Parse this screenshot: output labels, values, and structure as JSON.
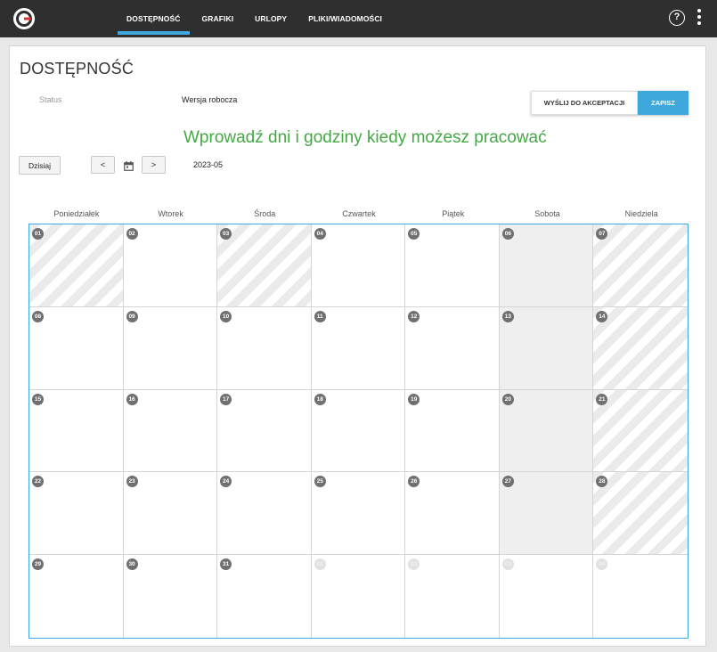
{
  "nav": {
    "items": [
      {
        "label": "DOSTĘPNOŚĆ",
        "active": true
      },
      {
        "label": "GRAFIKI",
        "active": false
      },
      {
        "label": "URLOPY",
        "active": false
      },
      {
        "label": "PLIKI/WIADOMOŚCI",
        "active": false
      }
    ],
    "help_glyph": "?"
  },
  "page": {
    "title": "DOSTĘPNOŚĆ",
    "status_label": "Status",
    "status_value": "Wersja robocza",
    "send_button": "WYŚLIJ DO AKCEPTACJI",
    "save_button": "ZAPISZ",
    "headline": "Wprowadź dni i godziny kiedy możesz pracować"
  },
  "toolbar": {
    "today_label": "Dzisiaj",
    "prev_label": "<",
    "next_label": ">",
    "month": "2023-05"
  },
  "calendar": {
    "weekdays": [
      "Poniedziałek",
      "Wtorek",
      "Środa",
      "Czwartek",
      "Piątek",
      "Sobota",
      "Niedziela"
    ],
    "days": [
      {
        "n": "01",
        "style": "striped"
      },
      {
        "n": "02",
        "style": "plain"
      },
      {
        "n": "03",
        "style": "striped"
      },
      {
        "n": "04",
        "style": "plain"
      },
      {
        "n": "05",
        "style": "plain"
      },
      {
        "n": "06",
        "style": "gray"
      },
      {
        "n": "07",
        "style": "striped"
      },
      {
        "n": "08",
        "style": "plain"
      },
      {
        "n": "09",
        "style": "plain"
      },
      {
        "n": "10",
        "style": "plain"
      },
      {
        "n": "11",
        "style": "plain"
      },
      {
        "n": "12",
        "style": "plain"
      },
      {
        "n": "13",
        "style": "gray"
      },
      {
        "n": "14",
        "style": "striped"
      },
      {
        "n": "15",
        "style": "plain"
      },
      {
        "n": "16",
        "style": "plain"
      },
      {
        "n": "17",
        "style": "plain"
      },
      {
        "n": "18",
        "style": "plain"
      },
      {
        "n": "19",
        "style": "plain"
      },
      {
        "n": "20",
        "style": "gray"
      },
      {
        "n": "21",
        "style": "striped"
      },
      {
        "n": "22",
        "style": "plain"
      },
      {
        "n": "23",
        "style": "plain"
      },
      {
        "n": "24",
        "style": "plain"
      },
      {
        "n": "25",
        "style": "plain"
      },
      {
        "n": "26",
        "style": "plain"
      },
      {
        "n": "27",
        "style": "gray"
      },
      {
        "n": "28",
        "style": "striped"
      },
      {
        "n": "29",
        "style": "plain"
      },
      {
        "n": "30",
        "style": "plain"
      },
      {
        "n": "31",
        "style": "plain"
      },
      {
        "n": "01",
        "style": "other"
      },
      {
        "n": "02",
        "style": "other"
      },
      {
        "n": "03",
        "style": "other"
      },
      {
        "n": "04",
        "style": "other"
      }
    ]
  },
  "colors": {
    "accent": "#3ea8dc",
    "headline": "#44a844",
    "topbar": "#2f2f2f",
    "weekend_gray": "#efefef"
  },
  "icons": [
    "logo-icon",
    "help-icon",
    "more-vertical-icon",
    "calendar-icon"
  ]
}
